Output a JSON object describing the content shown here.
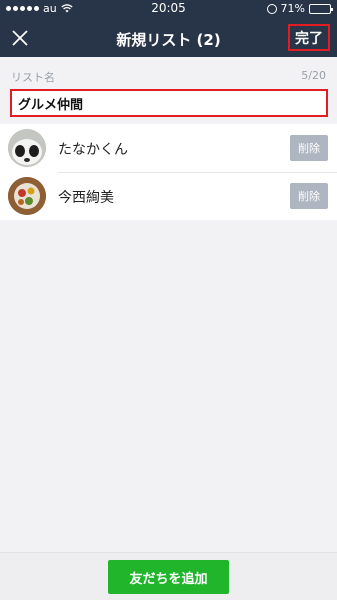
{
  "status_bar": {
    "carrier": "au",
    "time": "20:05",
    "battery": "71%"
  },
  "nav": {
    "title": "新規リスト (2)",
    "done_label": "完了"
  },
  "list_name": {
    "label": "リスト名",
    "count": "5/20",
    "value": "グルメ仲間"
  },
  "members": [
    {
      "name": "たなかくん",
      "delete_label": "削除",
      "avatar": "panda-avatar"
    },
    {
      "name": "今西絢美",
      "delete_label": "削除",
      "avatar": "food-avatar"
    }
  ],
  "footer": {
    "add_label": "友だちを追加"
  },
  "colors": {
    "header_bg": "#283447",
    "accent_green": "#21b52c",
    "highlight_red": "#e31b23"
  }
}
